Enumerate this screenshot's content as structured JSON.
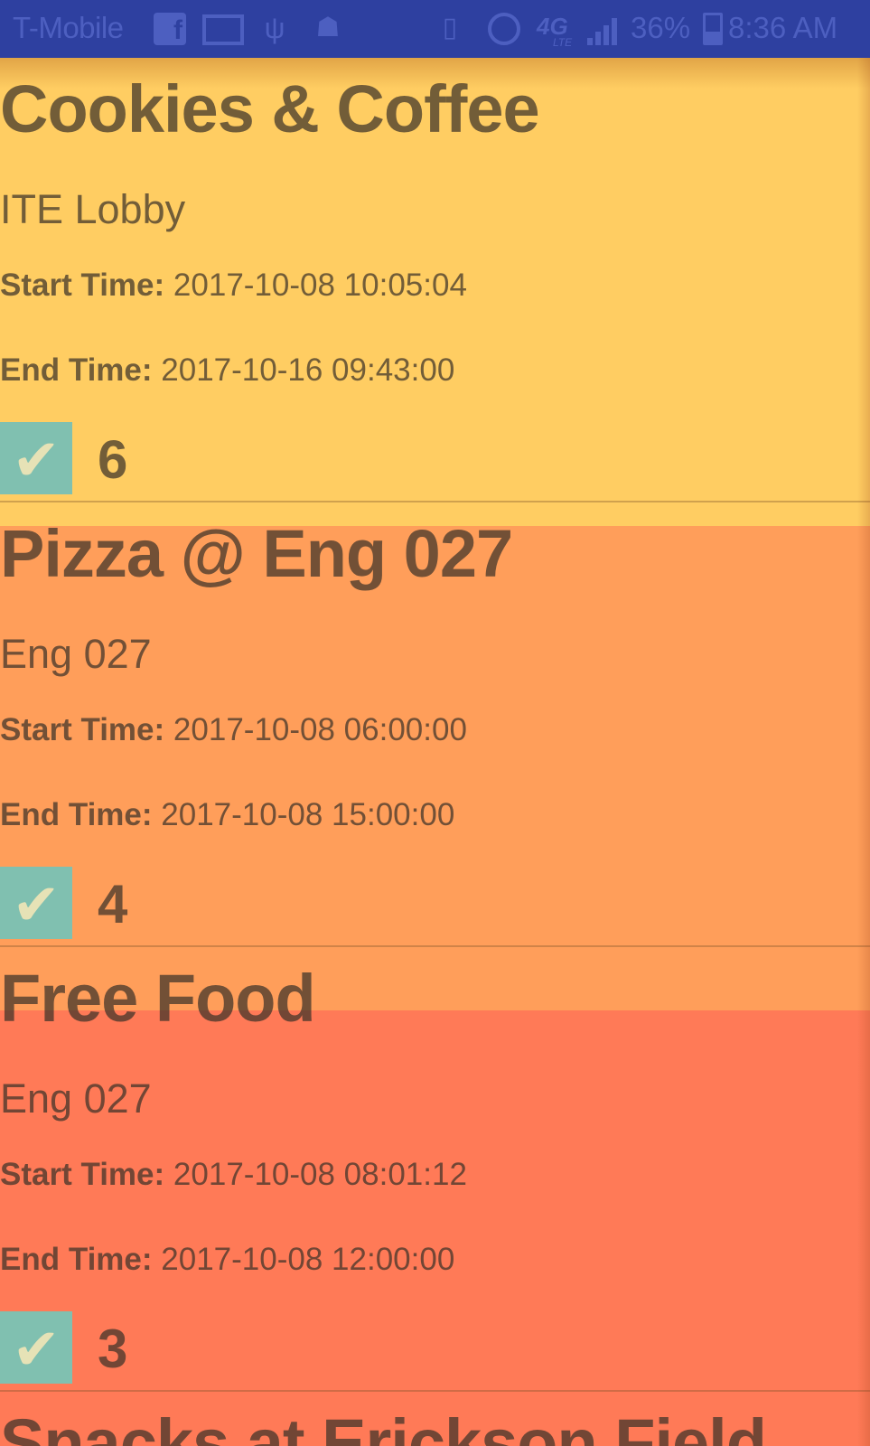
{
  "status_bar": {
    "carrier": "T-Mobile",
    "network": "4G",
    "network_sub": "LTE",
    "battery": "36%",
    "time": "8:36 AM",
    "icons": [
      "facebook-icon",
      "mail-icon",
      "usb-icon",
      "bug-icon",
      "vibrate-icon",
      "alarm-icon",
      "signal-icon",
      "battery-charging-icon"
    ]
  },
  "colors": {
    "status_bar": "#2E40A0",
    "band_yellow": "#FFCD62",
    "band_orange": "#FF9E5A",
    "band_red": "#FF7A57",
    "checkbox": "#80C0B0"
  },
  "labels": {
    "start": "Start Time:",
    "end": "End Time:"
  },
  "events": [
    {
      "name": "Cookies & Coffee",
      "location": "ITE Lobby",
      "start": "2017-10-08 10:05:04",
      "end": "2017-10-16 09:43:00",
      "checked": true,
      "count": "6"
    },
    {
      "name": "Pizza @ Eng 027",
      "location": "Eng 027",
      "start": "2017-10-08 06:00:00",
      "end": "2017-10-08 15:00:00",
      "checked": true,
      "count": "4"
    },
    {
      "name": "Free Food",
      "location": "Eng 027",
      "start": "2017-10-08 08:01:12",
      "end": "2017-10-08 12:00:00",
      "checked": true,
      "count": "3"
    },
    {
      "name": "Snacks at Erickson Field"
    }
  ]
}
